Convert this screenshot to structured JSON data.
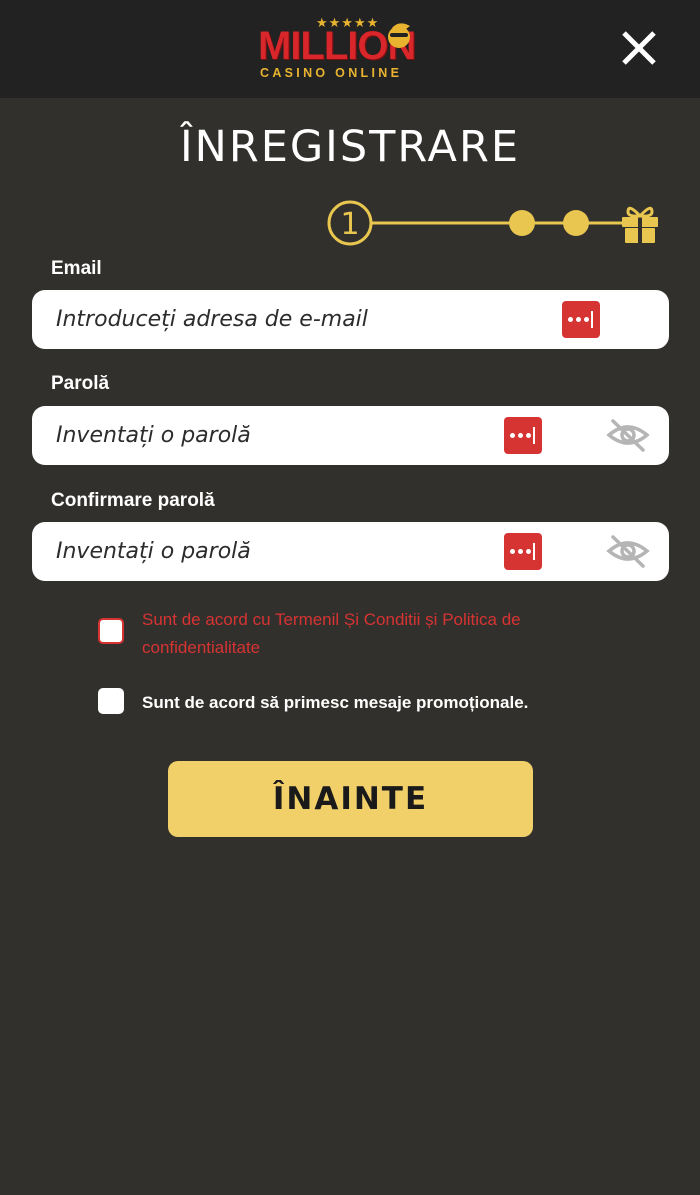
{
  "header": {
    "logo_word": "MILLION",
    "logo_subtitle": "CASINO ONLINE",
    "logo_stars": "★★★★★"
  },
  "title": "ÎNREGISTRARE",
  "stepper": {
    "current_step": "1",
    "total_steps": 4
  },
  "form": {
    "email": {
      "label": "Email",
      "placeholder": "Introduceți adresa de e-mail",
      "value": ""
    },
    "password": {
      "label": "Parolă",
      "placeholder": "Inventați o parolă",
      "value": ""
    },
    "confirm_password": {
      "label": "Confirmare parolă",
      "placeholder": "Inventați o parolă",
      "value": ""
    }
  },
  "consents": {
    "terms_prefix": "Sunt de acord cu ",
    "terms_link": "Termenil Și Conditii",
    "terms_and": " și ",
    "privacy_link": "Politica de confidentialitate",
    "terms_checked": false,
    "promo_text": "Sunt de acord să primesc mesaje promoționale.",
    "promo_checked": false
  },
  "next_button": "ÎNAINTE",
  "colors": {
    "background": "#32302c",
    "header": "#222222",
    "accent_gold": "#e8c64f",
    "button_gold": "#f1d06a",
    "error_red": "#d63333",
    "logo_red": "#d8262a"
  }
}
